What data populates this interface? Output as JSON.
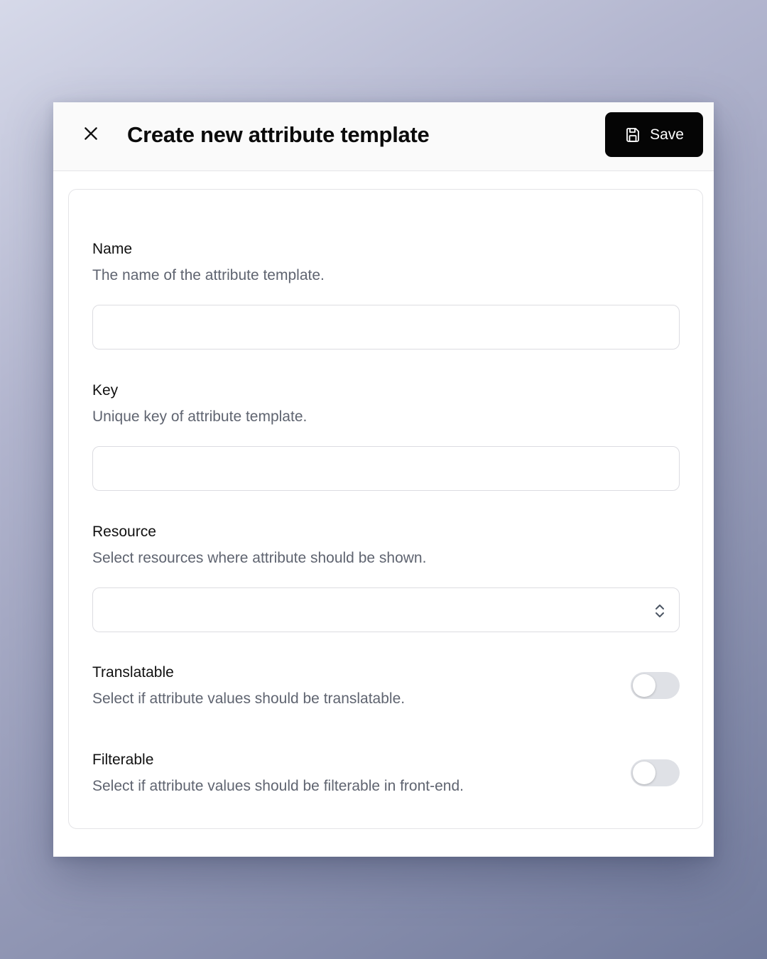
{
  "modal": {
    "title": "Create new attribute template",
    "save_label": "Save",
    "close_icon": "close-icon",
    "save_icon": "floppy-disk-icon"
  },
  "fields": {
    "name": {
      "label": "Name",
      "help": "The name of the attribute template.",
      "value": ""
    },
    "key": {
      "label": "Key",
      "help": "Unique key of attribute template.",
      "value": ""
    },
    "resource": {
      "label": "Resource",
      "help": "Select resources where attribute should be shown.",
      "selected": ""
    },
    "translatable": {
      "label": "Translatable",
      "help": "Select if attribute values should be translatable.",
      "checked": false
    },
    "filterable": {
      "label": "Filterable",
      "help": "Select if attribute values should be filterable in front-end.",
      "checked": false
    }
  },
  "colors": {
    "primary_button": "#050505",
    "toggle_off": "#dfe1e6",
    "help_text": "#5f6470"
  }
}
